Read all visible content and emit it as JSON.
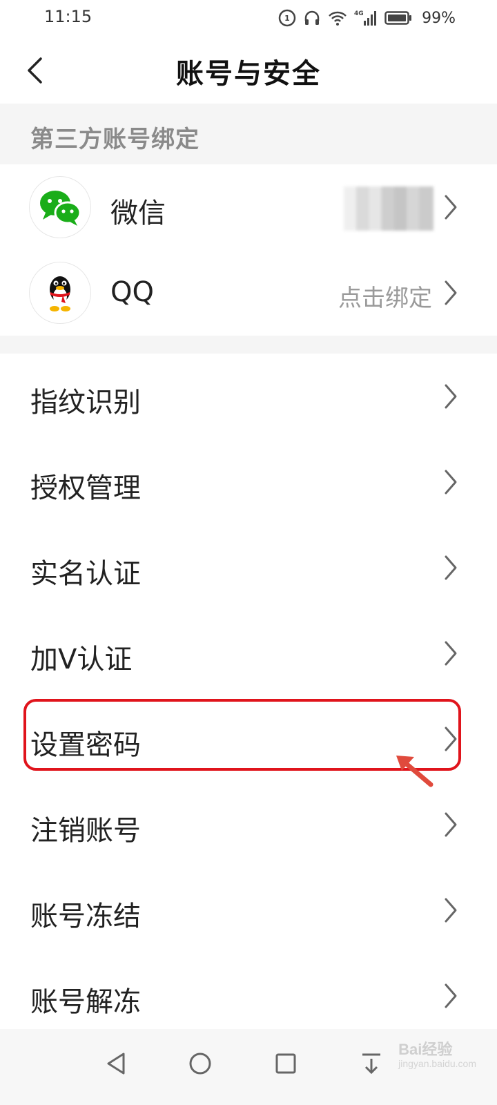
{
  "status_bar": {
    "time": "11:15",
    "network": "4G",
    "battery": "99%"
  },
  "header": {
    "title": "账号与安全"
  },
  "third_party": {
    "section_title": "第三方账号绑定",
    "accounts": [
      {
        "label": "微信",
        "value": ""
      },
      {
        "label": "QQ",
        "value": "点击绑定"
      }
    ]
  },
  "menu": {
    "items": [
      {
        "label": "指纹识别"
      },
      {
        "label": "授权管理"
      },
      {
        "label": "实名认证"
      },
      {
        "label": "加V认证"
      },
      {
        "label": "设置密码"
      },
      {
        "label": "注销账号"
      },
      {
        "label": "账号冻结"
      },
      {
        "label": "账号解冻"
      }
    ]
  },
  "watermark": {
    "brand": "Bai经验",
    "url": "jingyan.baidu.com"
  },
  "colors": {
    "section_bg": "#f5f5f5",
    "highlight": "#e0141c",
    "wechat_green": "#1aad19",
    "secondary_text": "#9a9a9a"
  }
}
